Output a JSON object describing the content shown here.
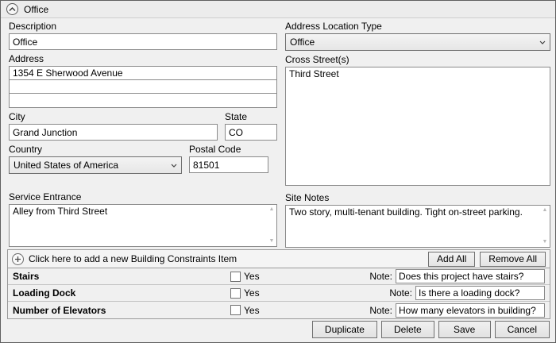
{
  "header": {
    "title": "Office"
  },
  "left": {
    "description": {
      "label": "Description",
      "value": "Office"
    },
    "address": {
      "label": "Address",
      "lines": [
        "1354 E Sherwood Avenue",
        "",
        ""
      ]
    },
    "city": {
      "label": "City",
      "value": "Grand Junction"
    },
    "state": {
      "label": "State",
      "value": "CO"
    },
    "country": {
      "label": "Country",
      "value": "United States of America"
    },
    "postal_code": {
      "label": "Postal Code",
      "value": "81501"
    },
    "service_entrance": {
      "label": "Service Entrance",
      "value": "Alley from Third Street"
    }
  },
  "right": {
    "address_location_type": {
      "label": "Address Location Type",
      "value": "Office"
    },
    "cross_streets": {
      "label": "Cross Street(s)",
      "value": "Third Street"
    },
    "site_notes": {
      "label": "Site Notes",
      "value": "Two story, multi-tenant building. Tight on-street parking."
    }
  },
  "constraints": {
    "add_row_label": "Click here to add a new Building Constraints Item",
    "add_all_label": "Add All",
    "remove_all_label": "Remove All",
    "yes_label": "Yes",
    "note_label": "Note:",
    "items": [
      {
        "name": "Stairs",
        "checked": false,
        "note": "Does this project have stairs?"
      },
      {
        "name": "Loading Dock",
        "checked": false,
        "note": "Is there a loading dock?"
      },
      {
        "name": "Number of Elevators",
        "checked": false,
        "note": "How many elevators in building?"
      }
    ]
  },
  "footer": {
    "duplicate_label": "Duplicate",
    "delete_label": "Delete",
    "save_label": "Save",
    "cancel_label": "Cancel"
  }
}
